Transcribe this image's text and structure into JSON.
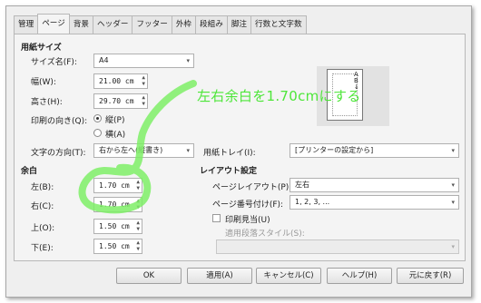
{
  "tabs": [
    "管理",
    "ページ",
    "背景",
    "ヘッダー",
    "フッター",
    "外枠",
    "段組み",
    "脚注",
    "行数と文字数"
  ],
  "paper": {
    "section": "用紙サイズ",
    "size_label": "サイズ名(F):",
    "size_value": "A4",
    "width_label": "幅(W):",
    "width_value": "21.00 cm",
    "height_label": "高さ(H):",
    "height_value": "29.70 cm",
    "orientation_label": "印刷の向き(Q):",
    "portrait_label": "縦(P)",
    "landscape_label": "横(A)",
    "textdir_label": "文字の方向(T):",
    "textdir_value": "右から左へ(縦書き)",
    "tray_label": "用紙トレイ(I):",
    "tray_value": "[プリンターの設定から]"
  },
  "preview": {
    "direction_glyphs": "A\nB\n↓"
  },
  "margins": {
    "section": "余白",
    "left_label": "左(B):",
    "left_value": "1.70 cm",
    "right_label": "右(C):",
    "right_value": "1.70 cm",
    "top_label": "上(O):",
    "top_value": "1.50 cm",
    "bottom_label": "下(E):",
    "bottom_value": "1.50 cm"
  },
  "layout": {
    "section": "レイアウト設定",
    "page_layout_label": "ページレイアウト(P):",
    "page_layout_value": "左右",
    "numbering_label": "ページ番号付け(F):",
    "numbering_value": "1, 2, 3, ...",
    "register_label": "印刷見当(U)",
    "ref_style_label": "適用段落スタイル(S):",
    "ref_style_value": ""
  },
  "buttons": {
    "ok": "OK",
    "apply": "適用(A)",
    "cancel": "キャンセル(C)",
    "help": "ヘルプ(H)",
    "reset": "元に戻す(R)"
  },
  "annotation": "左右余白を1.70cmにする",
  "colors": {
    "annotation": "#4ee63a"
  }
}
